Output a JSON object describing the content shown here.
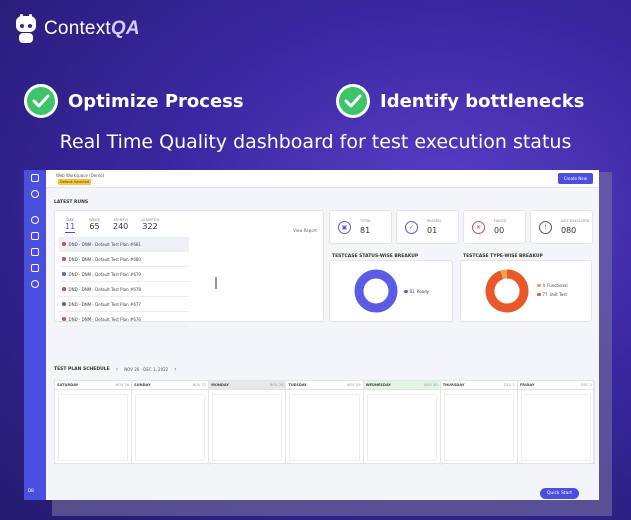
{
  "brand": {
    "name": "Context",
    "name_suffix": "QA"
  },
  "features": [
    {
      "label": "Optimize Process"
    },
    {
      "label": "Identify bottlenecks"
    }
  ],
  "headline": "Real Time Quality dashboard for test execution status",
  "dashboard": {
    "workspace_name": "Web Workspace (Demo)",
    "workspace_tag": "Default Selected",
    "create_button": "Create New",
    "latest_runs": {
      "title": "LATEST RUNS",
      "periods": [
        {
          "label": "DAY",
          "value": "11"
        },
        {
          "label": "WEEK",
          "value": "65"
        },
        {
          "label": "MONTH",
          "value": "240"
        },
        {
          "label": "QUARTER",
          "value": "322"
        }
      ],
      "view_report": "View Report",
      "runs": [
        {
          "label": "DND - DNM - Default Test Plan #681",
          "color": "#e04848"
        },
        {
          "label": "DND - DNM - Default Test Plan #680",
          "color": "#e04848"
        },
        {
          "label": "DND - DNM - Default Test Plan #679",
          "color": "#5b5be6"
        },
        {
          "label": "DND - DNM - Default Test Plan #678",
          "color": "#e04848"
        },
        {
          "label": "DND - DNM - Default Test Plan #677",
          "color": "#5b5be6"
        },
        {
          "label": "DND - DNM - Default Test Plan #676",
          "color": "#e04848"
        }
      ]
    },
    "stats": [
      {
        "label": "TOTAL",
        "value": "81",
        "color": "#5b5be6"
      },
      {
        "label": "PASSED",
        "value": "01",
        "color": "#5b5be6"
      },
      {
        "label": "FAILED",
        "value": "00",
        "color": "#e04848"
      },
      {
        "label": "NOT EXECUTED",
        "value": "080",
        "color": "#555a6e"
      }
    ],
    "status_breakup": {
      "title": "TESTCASE STATUS-WISE BREAKUP",
      "legend": [
        {
          "value": "81",
          "label": "Ready",
          "color": "#5b5be6"
        }
      ],
      "slices": [
        {
          "value": 81,
          "color": "#5b5be6"
        }
      ]
    },
    "type_breakup": {
      "title": "TESTCASE TYPE-WISE BREAKUP",
      "legend": [
        {
          "value": "4",
          "label": "Functional",
          "color": "#f0a050"
        },
        {
          "value": "77",
          "label": "Unit Test",
          "color": "#e8582a"
        }
      ],
      "slices": [
        {
          "value": 77,
          "color": "#e8582a"
        },
        {
          "value": 4,
          "color": "#f0a050"
        }
      ]
    },
    "schedule": {
      "title": "TEST PLAN SCHEDULE",
      "range": "NOV 26 - DEC 3, 2022",
      "days": [
        {
          "name": "SATURDAY",
          "date": "NOV 26"
        },
        {
          "name": "SUNDAY",
          "date": "NOV 27"
        },
        {
          "name": "MONDAY",
          "date": "NOV 28"
        },
        {
          "name": "TUESDAY",
          "date": "NOV 29"
        },
        {
          "name": "WEDNESDAY",
          "date": "NOV 30"
        },
        {
          "name": "THURSDAY",
          "date": "DEC 1"
        },
        {
          "name": "FRIDAY",
          "date": "DEC 2"
        }
      ]
    },
    "quick_start": "Quick Start",
    "sidebar_footer": "DB"
  }
}
